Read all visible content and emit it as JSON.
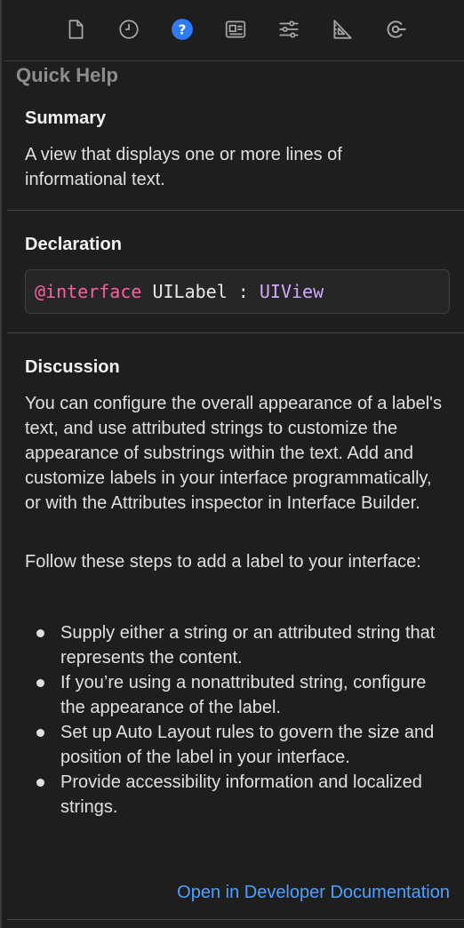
{
  "inspector_tabs": [
    {
      "icon": "file-icon",
      "selected": false
    },
    {
      "icon": "history-clock-icon",
      "selected": false
    },
    {
      "icon": "quick-help-icon",
      "selected": true
    },
    {
      "icon": "identity-card-icon",
      "selected": false
    },
    {
      "icon": "attributes-sliders-icon",
      "selected": false
    },
    {
      "icon": "size-ruler-icon",
      "selected": false
    },
    {
      "icon": "connections-icon",
      "selected": false
    }
  ],
  "quick_help": {
    "title": "Quick Help",
    "summary": {
      "heading": "Summary",
      "text": "A view that displays one or more lines of informational text."
    },
    "declaration": {
      "heading": "Declaration",
      "keyword": "@interface",
      "name": " UILabel : ",
      "superclass": "UIView"
    },
    "discussion": {
      "heading": "Discussion",
      "para1": "You can configure the overall appearance of a label's text, and use attributed strings to customize the appearance of substrings within the text. Add and customize labels in your interface programmatically, or with the Attributes inspector in Interface Builder.",
      "para2": "Follow these steps to add a label to your interface:",
      "bullets": [
        "Supply either a string or an attributed string that represents the content.",
        "If you’re using a nonattributed string, configure the appearance of the label.",
        "Set up Auto Layout rules to govern the size and position of the label in your interface.",
        "Provide accessibility information and localized strings."
      ]
    },
    "link": "Open in Developer Documentation"
  },
  "colors": {
    "background": "#1e1e1e",
    "selected_tab": "#2f7bf5",
    "keyword": "#fc5fa3",
    "type": "#d0a8ff",
    "link": "#4ea1ff"
  }
}
